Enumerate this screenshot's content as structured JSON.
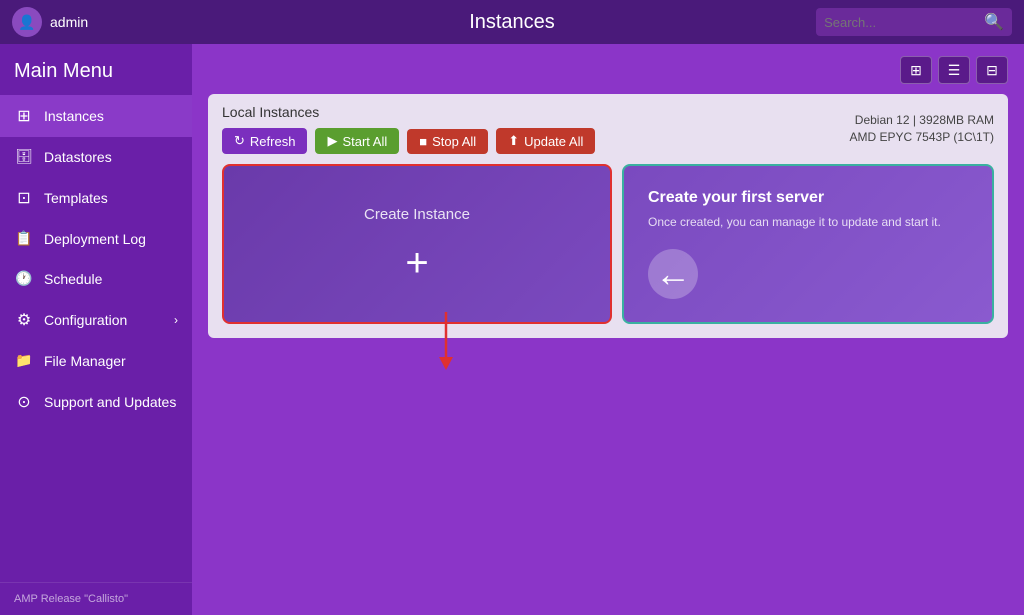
{
  "topbar": {
    "username": "admin",
    "title": "Instances",
    "search_placeholder": "Search..."
  },
  "sidebar": {
    "header": "Main Menu",
    "items": [
      {
        "id": "instances",
        "label": "Instances",
        "icon": "instances-icon",
        "active": true
      },
      {
        "id": "datastores",
        "label": "Datastores",
        "icon": "datastores-icon",
        "active": false
      },
      {
        "id": "templates",
        "label": "Templates",
        "icon": "templates-icon",
        "active": false
      },
      {
        "id": "deployment-log",
        "label": "Deployment Log",
        "icon": "deployment-icon",
        "active": false
      },
      {
        "id": "schedule",
        "label": "Schedule",
        "icon": "schedule-icon",
        "active": false
      },
      {
        "id": "configuration",
        "label": "Configuration",
        "icon": "config-icon",
        "active": false,
        "has_chevron": true
      },
      {
        "id": "file-manager",
        "label": "File Manager",
        "icon": "files-icon",
        "active": false
      },
      {
        "id": "support",
        "label": "Support and Updates",
        "icon": "support-icon",
        "active": false
      }
    ],
    "footer": "AMP Release \"Callisto\""
  },
  "content": {
    "panel_title": "Local Instances",
    "system_info_line1": "Debian  12 | 3928MB RAM",
    "system_info_line2": "AMD EPYC 7543P (1C\\1T)",
    "buttons": {
      "refresh": "Refresh",
      "start_all": "Start All",
      "stop_all": "Stop All",
      "update_all": "Update All"
    },
    "create_instance_label": "Create Instance",
    "help_title": "Create your first server",
    "help_text": "Once created, you can manage it to update and start it."
  }
}
